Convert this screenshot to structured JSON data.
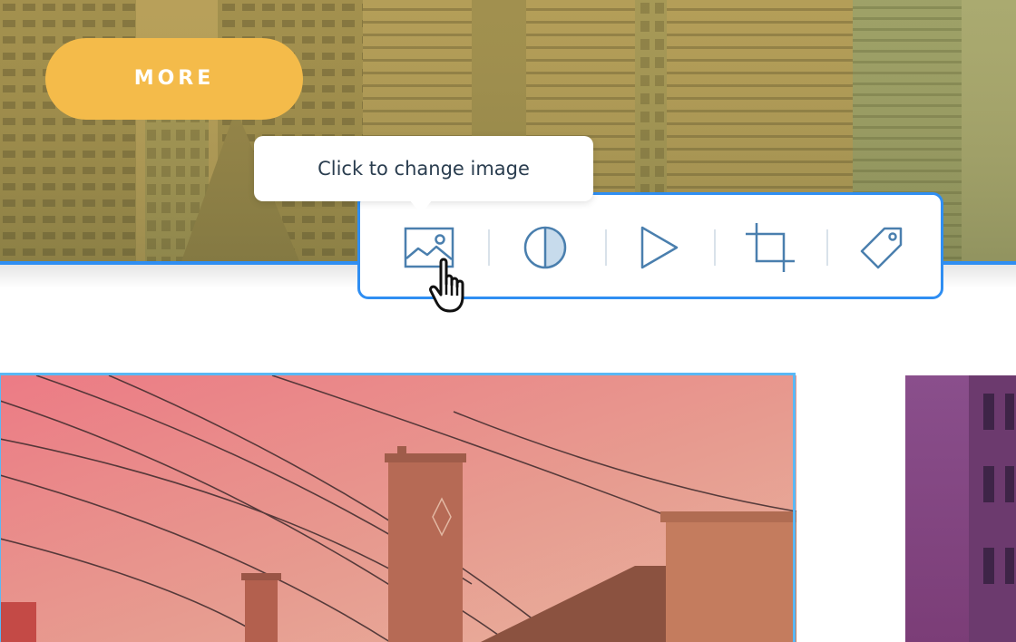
{
  "hero": {
    "more_label": "MORE"
  },
  "tooltip": {
    "text": "Click to change image"
  },
  "toolbar": {
    "tools": [
      {
        "name": "change-image",
        "icon": "image-icon"
      },
      {
        "name": "contrast",
        "icon": "contrast-icon"
      },
      {
        "name": "video",
        "icon": "play-icon"
      },
      {
        "name": "crop",
        "icon": "crop-icon"
      },
      {
        "name": "tag",
        "icon": "tag-icon"
      }
    ]
  },
  "colors": {
    "accent_blue": "#2f8ef2",
    "selected_frame": "#5ab8f5",
    "more_button": "#f4bb4a",
    "icon_stroke": "#4a7fae",
    "tooltip_text": "#2a3d4f"
  },
  "cursor": {
    "icon": "hand-pointer-icon"
  }
}
